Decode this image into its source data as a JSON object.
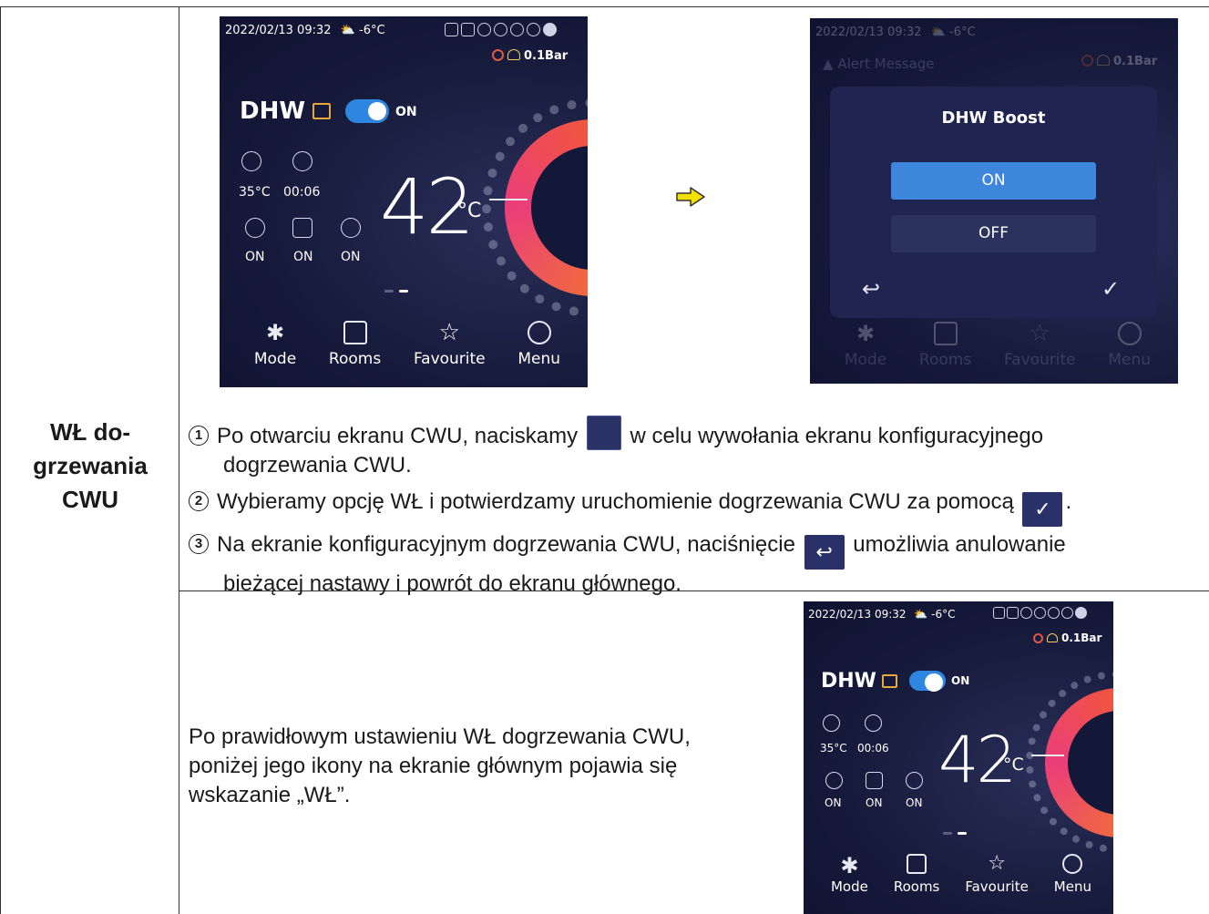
{
  "section_label": "WŁ do-\ngrzewania\nCWU",
  "screen_main": {
    "datetime": "2022/02/13 09:32",
    "outdoor_temp": "-6°C",
    "pressure": "0.1Bar",
    "title": "DHW",
    "toggle_state": "ON",
    "stat1_value": "35°C",
    "stat2_value": "00:06",
    "flag1": "ON",
    "flag2": "ON",
    "flag3": "ON",
    "temperature": "42",
    "temperature_unit": "°C",
    "nav": [
      "Mode",
      "Rooms",
      "Favourite",
      "Menu"
    ]
  },
  "screen_dialog": {
    "datetime": "2022/02/13 09:32",
    "outdoor_temp": "-6°C",
    "alert": "Alert Message",
    "pressure": "0.1Bar",
    "title": "DHW Boost",
    "option_on": "ON",
    "option_off": "OFF",
    "nav": [
      "Mode",
      "Rooms",
      "Favourite",
      "Menu"
    ]
  },
  "steps": [
    {
      "number": "1",
      "text_before_icon": "Po otwarciu ekranu CWU, naciskamy",
      "text_after_icon": " w celu wywołania ekranu konfiguracyjnego",
      "text_line2": "dogrzewania CWU."
    },
    {
      "number": "2",
      "text_before_icon": "Wybieramy opcję WŁ i potwierdzamy uruchomienie dogrzewania CWU za pomocą",
      "text_after_icon": "."
    },
    {
      "number": "3",
      "text_before_icon": "Na ekranie konfiguracyjnym dogrzewania CWU, naciśnięcie",
      "text_after_icon": " umożliwia anulowanie",
      "text_line2": "bieżącej nastawy i powrót do ekranu głównego."
    }
  ],
  "result_text": "Po prawidłowym ustawieniu WŁ dogrzewania CWU, poniżej jego ikony na ekranie głównym pojawia się wskazanie „WŁ”."
}
